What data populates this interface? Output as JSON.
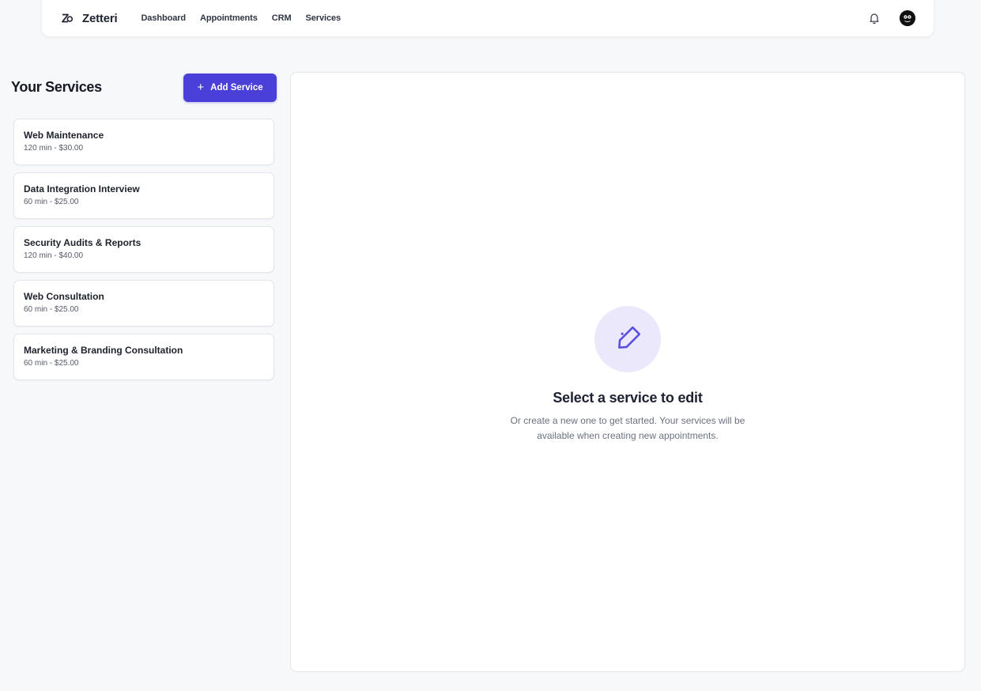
{
  "brand": {
    "name": "Zetteri"
  },
  "nav": {
    "links": [
      "Dashboard",
      "Appointments",
      "CRM",
      "Services"
    ]
  },
  "colors": {
    "accent": "#4a3fd8",
    "accent_light": "#ebe8fb",
    "page_bg": "#f7f8fa"
  },
  "icons": {
    "logo": "zetteri-logo-icon",
    "notifications": "bell-icon",
    "avatar": "user-avatar",
    "add": "plus-icon",
    "empty": "tag-icon"
  },
  "services_panel": {
    "title": "Your Services",
    "add_button": "Add Service",
    "items": [
      {
        "name": "Web Maintenance",
        "meta": "120 min - $30.00"
      },
      {
        "name": "Data Integration Interview",
        "meta": "60 min - $25.00"
      },
      {
        "name": "Security Audits & Reports",
        "meta": "120 min - $40.00"
      },
      {
        "name": "Web Consultation",
        "meta": "60 min - $25.00"
      },
      {
        "name": "Marketing & Branding Consultation",
        "meta": "60 min - $25.00"
      }
    ]
  },
  "empty_state": {
    "title": "Select a service to edit",
    "description": "Or create a new one to get started. Your services will be available when creating new appointments."
  }
}
